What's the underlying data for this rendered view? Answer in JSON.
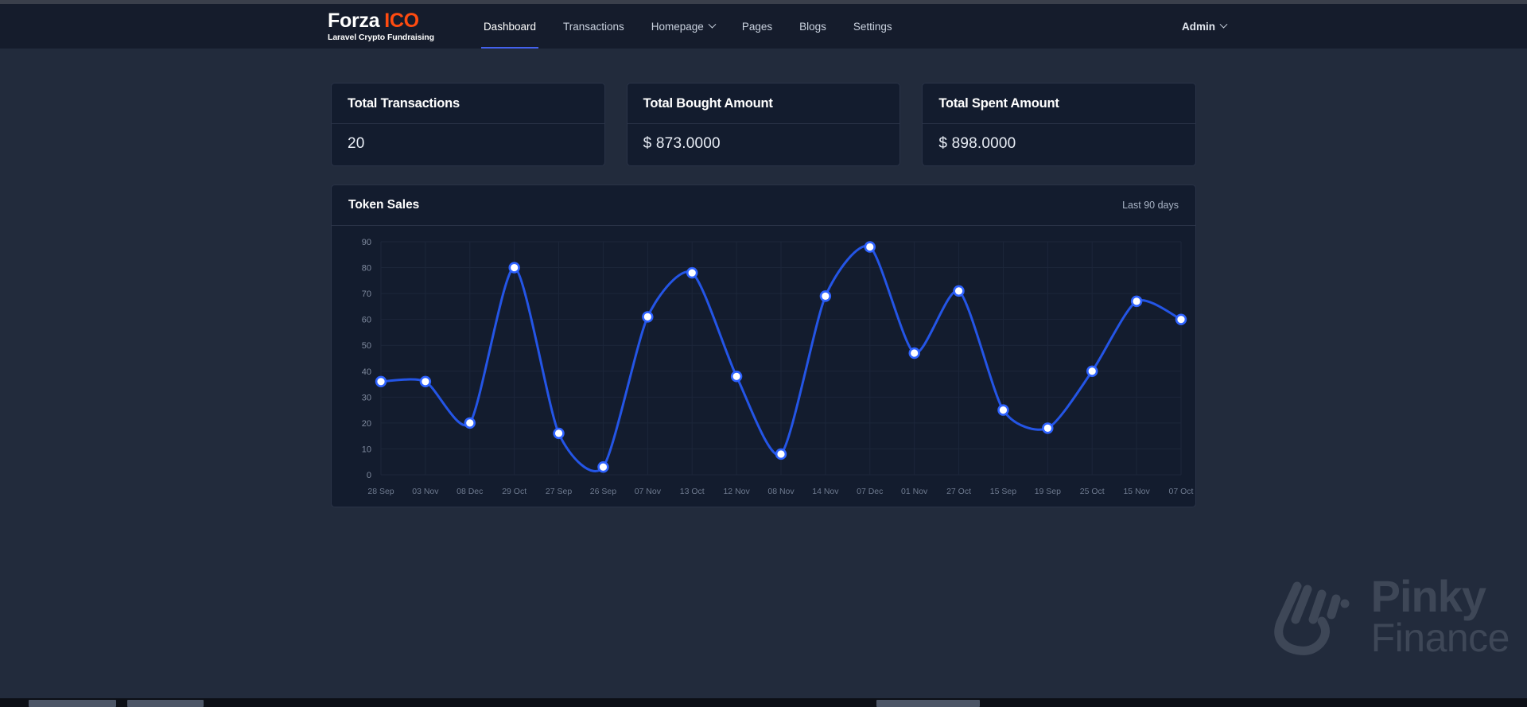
{
  "navbar": {
    "brand": {
      "word1": "Forza",
      "word2": "ICO",
      "tagline": "Laravel Crypto Fundraising"
    },
    "links": [
      {
        "label": "Dashboard",
        "active": true,
        "has_caret": false
      },
      {
        "label": "Transactions",
        "active": false,
        "has_caret": false
      },
      {
        "label": "Homepage",
        "active": false,
        "has_caret": true
      },
      {
        "label": "Pages",
        "active": false,
        "has_caret": false
      },
      {
        "label": "Blogs",
        "active": false,
        "has_caret": false
      },
      {
        "label": "Settings",
        "active": false,
        "has_caret": false
      }
    ],
    "account": {
      "label": "Admin",
      "has_caret": true
    }
  },
  "stats": [
    {
      "title": "Total Transactions",
      "value": "20"
    },
    {
      "title": "Total Bought Amount",
      "value": "$ 873.0000"
    },
    {
      "title": "Total Spent Amount",
      "value": "$ 898.0000"
    }
  ],
  "panel": {
    "title": "Token Sales",
    "meta": "Last 90 days"
  },
  "watermark": {
    "line1": "Pinky",
    "line2": "Finance"
  },
  "colors": {
    "accent_blue": "#2455e6",
    "brand_orange": "#ff4b10",
    "page_bg": "#222b3c",
    "card_bg": "#131c2e",
    "navbar_bg": "#151c2c",
    "border": "#2a3347"
  },
  "chart_data": {
    "type": "line",
    "title": "Token Sales",
    "subtitle": "Last 90 days",
    "xlabel": "",
    "ylabel": "",
    "ylim": [
      0,
      90
    ],
    "yticks": [
      0,
      10,
      20,
      30,
      40,
      50,
      60,
      70,
      80,
      90
    ],
    "grid": true,
    "legend": "none",
    "smooth": true,
    "categories": [
      "28 Sep",
      "03 Nov",
      "08 Dec",
      "29 Oct",
      "27 Sep",
      "26 Sep",
      "07 Nov",
      "13 Oct",
      "12 Nov",
      "08 Nov",
      "14 Nov",
      "07 Dec",
      "01 Nov",
      "27 Oct",
      "15 Sep",
      "19 Sep",
      "25 Oct",
      "15 Nov",
      "07 Oct"
    ],
    "series": [
      {
        "name": "Token Sales",
        "color": "#2455e6",
        "values": [
          36,
          36,
          20,
          80,
          16,
          3,
          61,
          78,
          38,
          8,
          69,
          88,
          47,
          71,
          25,
          18,
          40,
          67,
          60
        ]
      }
    ]
  }
}
